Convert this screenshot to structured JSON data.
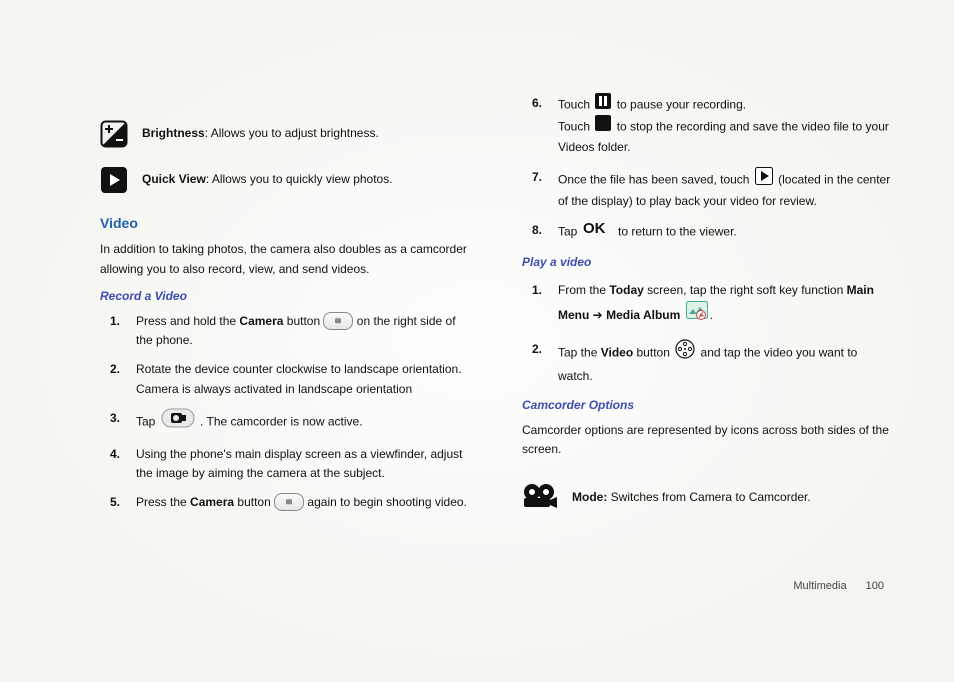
{
  "left": {
    "brightness_label": "Brightness",
    "brightness_desc": ": Allows you to adjust brightness.",
    "quickview_label": "Quick View",
    "quickview_desc": ": Allows you to quickly view photos.",
    "video_heading": "Video",
    "video_intro": "In addition to taking photos, the camera also doubles as a camcorder allowing you to also record, view, and send videos.",
    "record_heading": "Record a Video",
    "record": {
      "n1": "1.",
      "s1a": "Press and hold the ",
      "s1b": "Camera",
      "s1c": " button ",
      "s1d": " on the right side of the phone.",
      "n2": "2.",
      "s2": "Rotate the device counter clockwise to landscape orientation. Camera is always activated in landscape orientation",
      "n3": "3.",
      "s3a": "Tap ",
      "s3b": ". The camcorder is now active.",
      "n4": "4.",
      "s4": "Using the phone's main display screen as a viewfinder, adjust the image by aiming the camera at the subject.",
      "n5": "5.",
      "s5a": "Press the ",
      "s5b": "Camera",
      "s5c": " button ",
      "s5d": " again to begin shooting video."
    }
  },
  "right": {
    "rec_block": {
      "n6": "6.",
      "s6a": "Touch ",
      "s6b": " to pause your recording.",
      "s6c": "Touch ",
      "s6d": " to stop the recording and save the video file to your Videos folder.",
      "n7": "7.",
      "s7a": "Once the file has been saved, touch ",
      "s7b": " (located in the center of the display) to play back your video for review.",
      "n8": "8.",
      "s8a": "Tap ",
      "s8b": " to return to the viewer."
    },
    "play_heading": "Play a video",
    "play": {
      "n1": "1.",
      "s1a": "From the ",
      "s1b": "Today",
      "s1c": " screen, tap the right soft key function ",
      "s1d": "Main Menu",
      "s1e": " ➔ ",
      "s1f": "Media Album",
      "s1g": " ",
      "s1h": ".",
      "n2": "2.",
      "s2a": "Tap the ",
      "s2b": "Video",
      "s2c": " button ",
      "s2d": " and tap the video you want to watch."
    },
    "camopt_heading": "Camcorder Options",
    "camopt_intro": "Camcorder options are represented by icons across both sides of the screen.",
    "mode_label": "Mode:",
    "mode_desc": " Switches from Camera to Camcorder."
  },
  "footer": {
    "section": "Multimedia",
    "page": "100"
  }
}
